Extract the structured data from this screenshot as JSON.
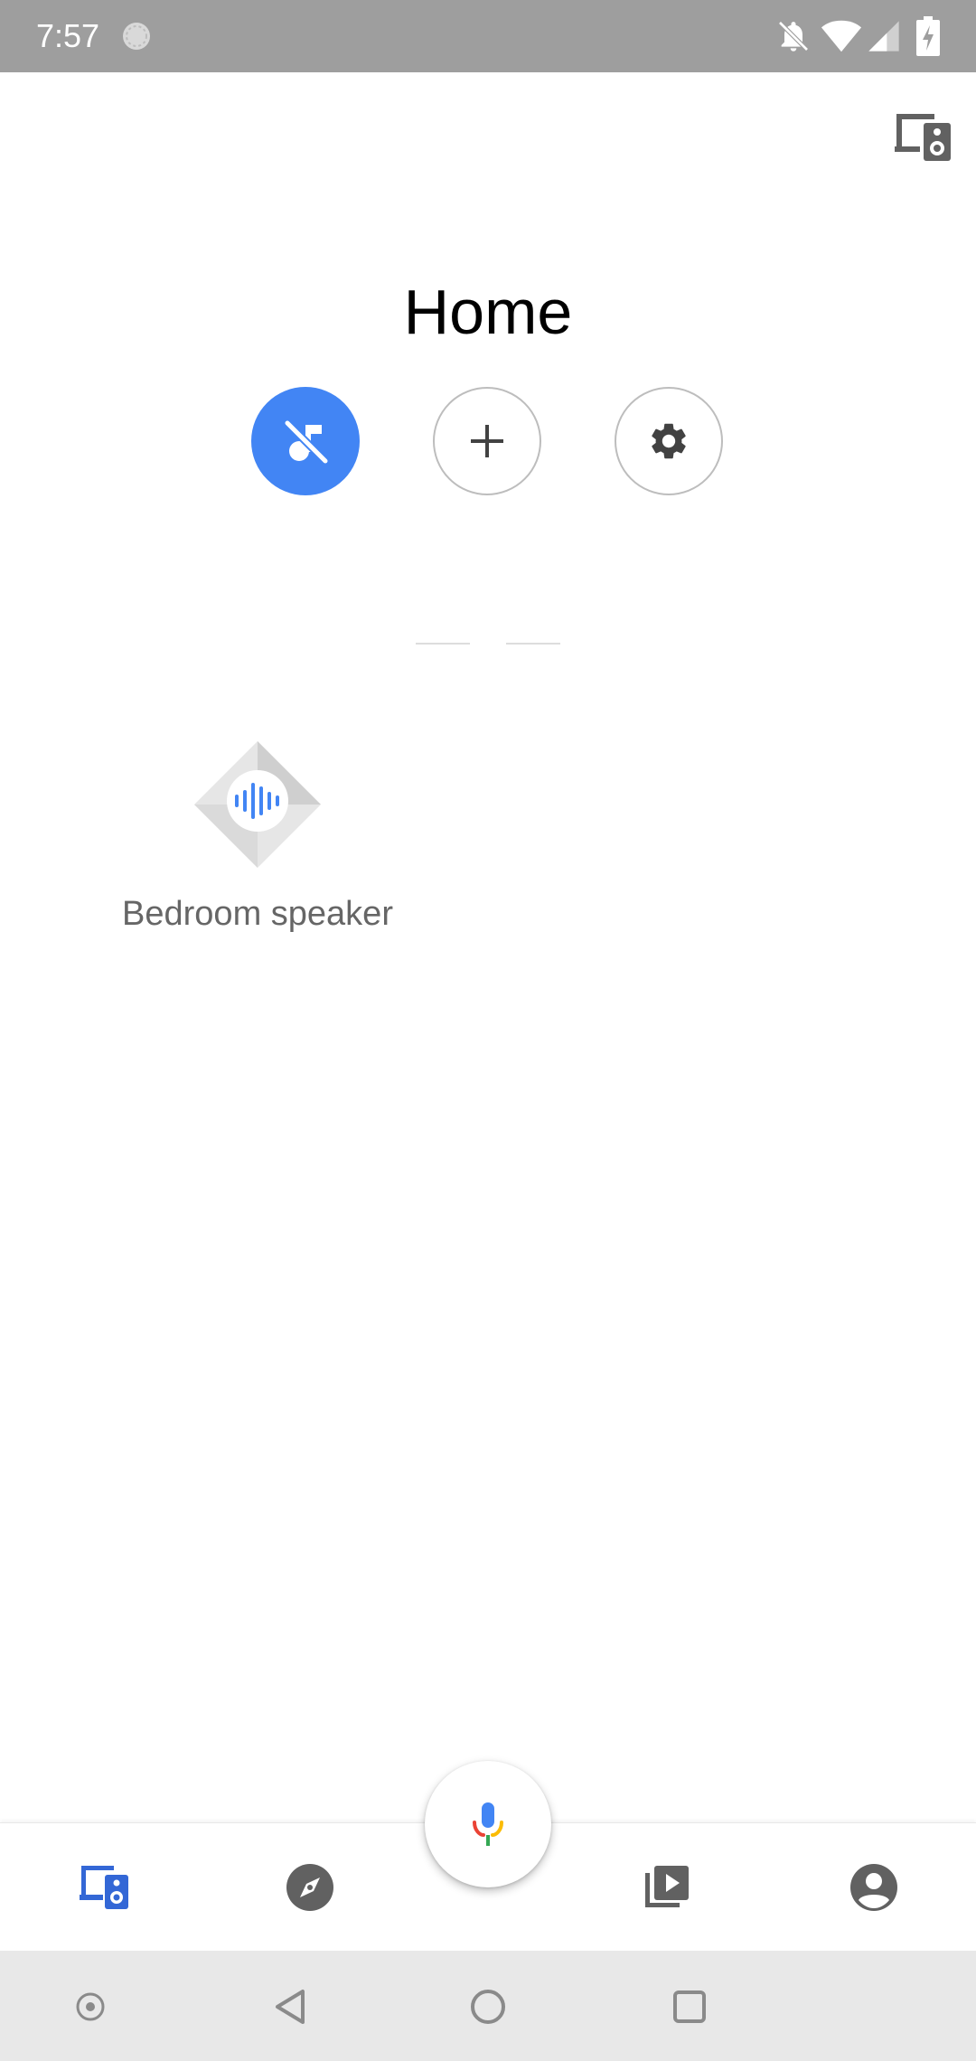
{
  "status_bar": {
    "time": "7:57",
    "icons": [
      "sync-spinner-icon",
      "notifications-off-icon",
      "wifi-icon",
      "cell-signal-icon",
      "battery-charging-icon"
    ]
  },
  "header": {
    "title": "Home",
    "cast_icon": "devices-speaker-icon"
  },
  "quick_actions": [
    {
      "icon": "music-off-icon",
      "active": true
    },
    {
      "icon": "plus-icon",
      "active": false
    },
    {
      "icon": "gear-icon",
      "active": false
    }
  ],
  "devices": [
    {
      "label": "Bedroom speaker",
      "icon": "speaker-device-icon"
    }
  ],
  "bottom_nav": {
    "items": [
      "devices-tab-icon",
      "discover-compass-icon",
      "media-library-icon",
      "account-icon"
    ],
    "fab_icon": "mic-icon"
  },
  "colors": {
    "accent": "#4285f4",
    "status_bar": "#9e9e9e",
    "system_nav": "#e8e8e8",
    "icon_gray": "#616161"
  }
}
